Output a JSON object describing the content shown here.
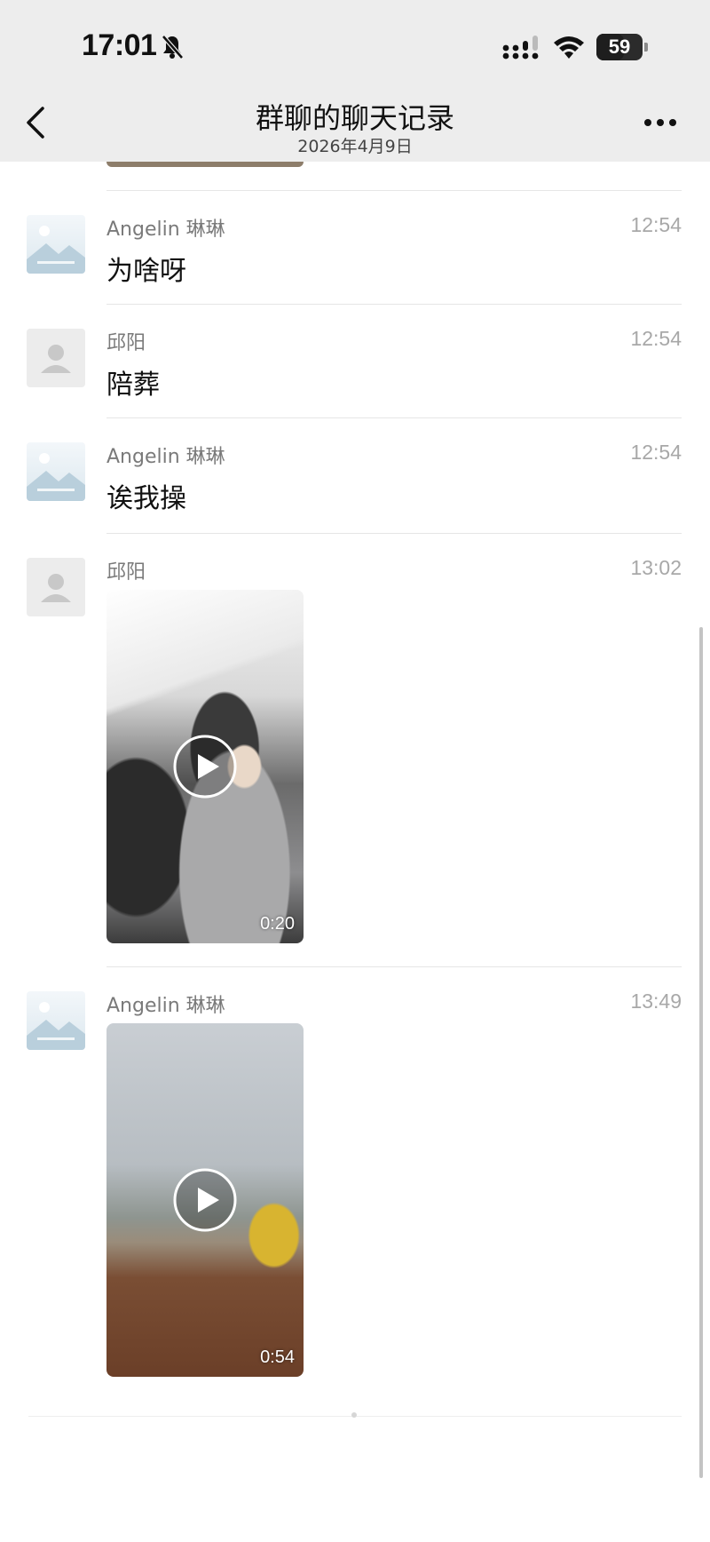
{
  "status_bar": {
    "time": "17:01",
    "battery_level": "59"
  },
  "nav": {
    "title": "群聊的聊天记录",
    "subtitle": "2026年4月9日"
  },
  "messages": [
    {
      "sender": "Angelin 琳琳",
      "time": "12:54",
      "text": "为啥呀",
      "avatar": "landscape-avatar"
    },
    {
      "sender": "邱阳",
      "time": "12:54",
      "text": "陪葬",
      "avatar": "person-placeholder-avatar"
    },
    {
      "sender": "Angelin 琳琳",
      "time": "12:54",
      "text": "诶我操",
      "avatar": "landscape-avatar"
    },
    {
      "sender": "邱阳",
      "time": "13:02",
      "video_duration": "0:20",
      "avatar": "person-placeholder-avatar"
    },
    {
      "sender": "Angelin 琳琳",
      "time": "13:49",
      "video_duration": "0:54",
      "avatar": "landscape-avatar"
    }
  ],
  "colors": {
    "header_bg": "#ededed",
    "sender_text": "#7a7a7a",
    "time_text": "#a8a8a8"
  }
}
